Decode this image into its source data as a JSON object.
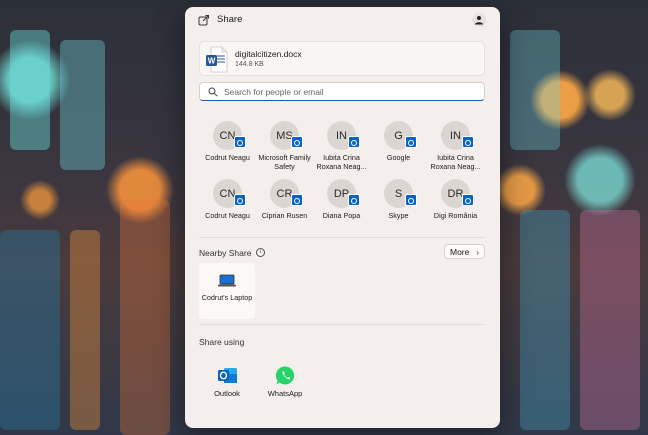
{
  "header": {
    "title": "Share"
  },
  "file": {
    "name": "digitalcitizen.docx",
    "size": "144.8 KB"
  },
  "search": {
    "placeholder": "Search for people or email"
  },
  "contacts": [
    {
      "initials": "CN",
      "name": "Codrut Neagu"
    },
    {
      "initials": "MS",
      "name": "Microsoft Family Safety"
    },
    {
      "initials": "IN",
      "name": "Iubita Crina Roxana Neag..."
    },
    {
      "initials": "G",
      "name": "Google"
    },
    {
      "initials": "IN",
      "name": "Iubita Crina Roxana Neag..."
    },
    {
      "initials": "CN",
      "name": "Codrut Neagu"
    },
    {
      "initials": "CR",
      "name": "Ciprian Rusen"
    },
    {
      "initials": "DP",
      "name": "Diana Popa"
    },
    {
      "initials": "S",
      "name": "Skype"
    },
    {
      "initials": "DR",
      "name": "Digi România"
    }
  ],
  "nearby": {
    "title": "Nearby Share",
    "more_label": "More",
    "devices": [
      {
        "name": "Codrut's Laptop"
      }
    ]
  },
  "share_using": {
    "title": "Share using",
    "apps": [
      {
        "name": "Outlook",
        "icon": "outlook-icon"
      },
      {
        "name": "WhatsApp",
        "icon": "whatsapp-icon"
      }
    ]
  },
  "colors": {
    "accent": "#1a5fb4",
    "outlook_badge": "#0a64c8",
    "whatsapp": "#25d366",
    "word": "#2b5797"
  }
}
